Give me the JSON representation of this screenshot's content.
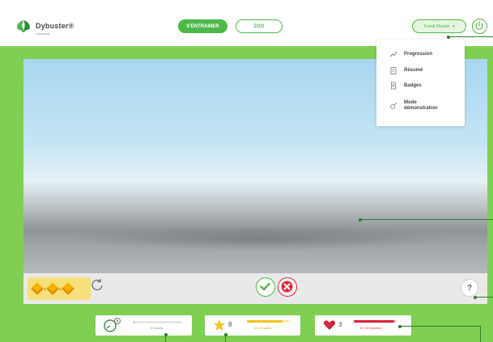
{
  "app": {
    "logo_name": "Dybuster®",
    "logo_sub": "Calcularis"
  },
  "header": {
    "mode_tabs": [
      {
        "label": "S'ENTRAINER",
        "active": true
      },
      {
        "label": "ZOO",
        "active": false
      }
    ],
    "user_name": "Frank Muster",
    "user_caret": "▾"
  },
  "menu": {
    "items": [
      {
        "label": "Progression",
        "icon": "progression-chart-icon"
      },
      {
        "label": "Résumé",
        "icon": "clipboard-icon"
      },
      {
        "label": "Badges",
        "icon": "badge-icon"
      },
      {
        "label": "Mode démonstration",
        "icon": "demo-icon"
      }
    ]
  },
  "exercise": {
    "help_label": "?"
  },
  "stats": {
    "time": {
      "caption": "8 minutes",
      "progress": 0.02
    },
    "stars": {
      "count": "8",
      "caption": "44 / 53 points",
      "progress": 0.83
    },
    "hearts": {
      "count": "3",
      "caption": "87 / 92 monstres",
      "progress": 0.95
    }
  },
  "colors": {
    "brand_green": "#4fb84a",
    "stage_green": "#7fcf52",
    "error_red": "#e0263a",
    "star_yellow": "#f7c21f",
    "heart_red": "#d9233a"
  }
}
